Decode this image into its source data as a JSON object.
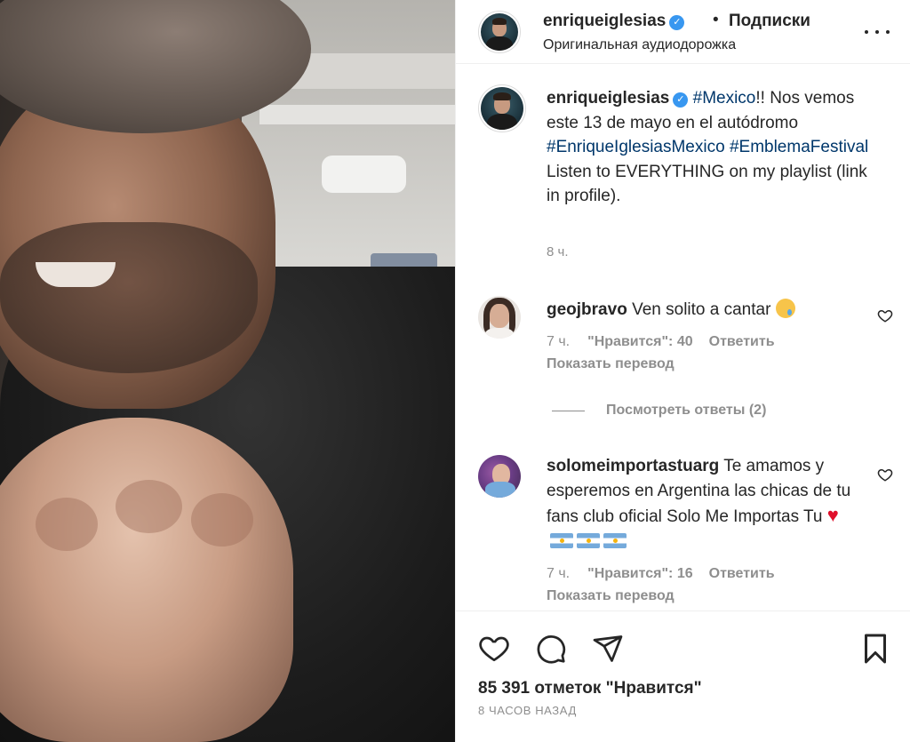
{
  "header": {
    "username": "enriqueiglesias",
    "separator": "•",
    "follow_label": "Подписки",
    "audio_label": "Оригинальная аудиодорожка"
  },
  "caption": {
    "username": "enriqueiglesias",
    "tag_mexico": "#Mexico",
    "text_1": "!! Nos vemos este 13 de mayo en el autódromo ",
    "tag_enrique": "#EnriqueIglesiasMexico",
    "tag_emblema": "#EmblemaFestival",
    "text_2": " Listen to EVERYTHING on my playlist (link in profile).",
    "time": "8 ч."
  },
  "comments": [
    {
      "username": "geojbravo",
      "text": "Ven solito a cantar",
      "emoji": "crying-face",
      "time": "7 ч.",
      "likes_label": "\"Нравится\": 40",
      "reply_label": "Ответить",
      "translate_label": "Показать перевод"
    },
    {
      "username": "solomeimportastuarg",
      "text": "Te amamos y esperemos en Argentina las chicas de tu fans club oficial Solo Me Importas Tu",
      "emoji": "red-heart argentina-flag argentina-flag argentina-flag",
      "time": "7 ч.",
      "likes_label": "\"Нравится\": 16",
      "reply_label": "Ответить",
      "translate_label": "Показать перевод"
    }
  ],
  "replies_toggle": "Посмотреть ответы (2)",
  "footer": {
    "likes": "85 391 отметок \"Нравится\"",
    "posted": "8 ЧАСОВ НАЗАД"
  },
  "icons": [
    "verified-badge-icon",
    "more-options-icon",
    "heart-icon",
    "comment-icon",
    "share-icon",
    "bookmark-icon"
  ],
  "colors": {
    "link": "#00376b",
    "muted": "#8e8e8e",
    "verified": "#3897f0",
    "text": "#262626"
  }
}
